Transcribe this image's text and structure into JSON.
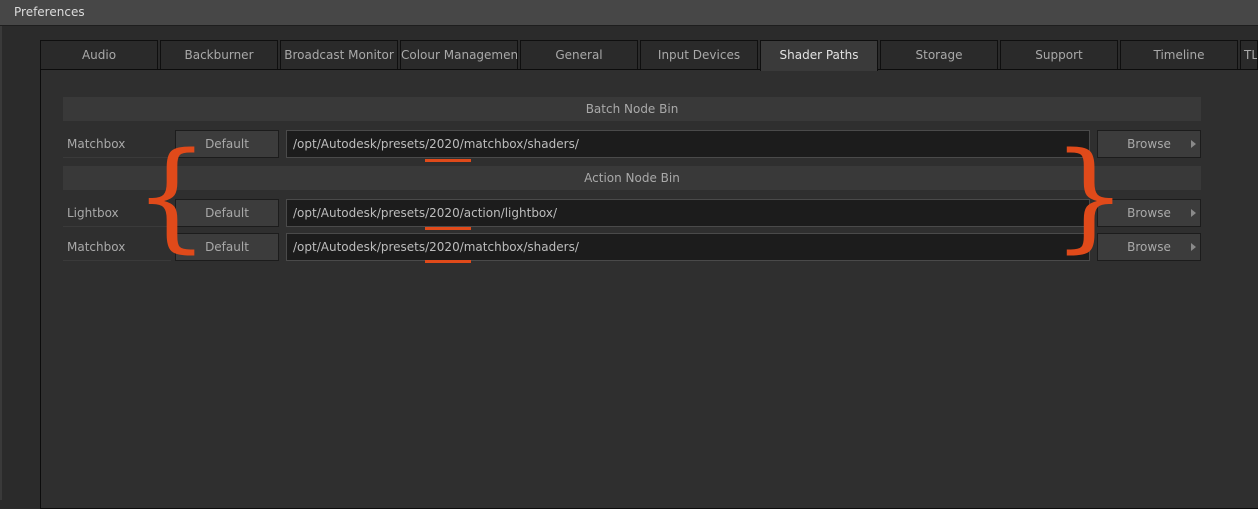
{
  "window": {
    "title": "Preferences"
  },
  "tabs": [
    {
      "label": "Audio"
    },
    {
      "label": "Backburner"
    },
    {
      "label": "Broadcast Monitor"
    },
    {
      "label": "Colour Management"
    },
    {
      "label": "General"
    },
    {
      "label": "Input Devices"
    },
    {
      "label": "Shader Paths",
      "active": true
    },
    {
      "label": "Storage"
    },
    {
      "label": "Support"
    },
    {
      "label": "Timeline"
    },
    {
      "label": "TL"
    }
  ],
  "batch_node_bin": {
    "header": "Batch Node Bin",
    "rows": [
      {
        "label": "Matchbox",
        "default_label": "Default",
        "path": "/opt/Autodesk/presets/2020/matchbox/shaders/",
        "browse_label": "Browse"
      }
    ]
  },
  "action_node_bin": {
    "header": "Action Node Bin",
    "rows": [
      {
        "label": "Lightbox",
        "default_label": "Default",
        "path": "/opt/Autodesk/presets/2020/action/lightbox/",
        "browse_label": "Browse"
      },
      {
        "label": "Matchbox",
        "default_label": "Default",
        "path": "/opt/Autodesk/presets/2020/matchbox/shaders/",
        "browse_label": "Browse"
      }
    ]
  },
  "annotation": {
    "color": "#e04a1a"
  }
}
